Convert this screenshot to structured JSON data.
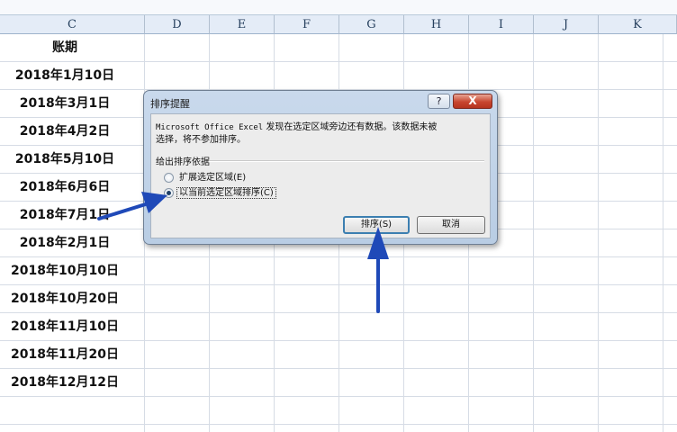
{
  "columns": [
    "C",
    "D",
    "E",
    "F",
    "G",
    "H",
    "I",
    "J",
    "K"
  ],
  "column_c_header": "账期",
  "column_c_values": [
    "2018年1月10日",
    "2018年3月1日",
    "2018年4月2日",
    "2018年5月10日",
    "2018年6月6日",
    "2018年7月1日",
    "2018年2月1日",
    "2018年10月10日",
    "2018年10月20日",
    "2018年11月10日",
    "2018年11月20日",
    "2018年12月12日"
  ],
  "dialog": {
    "title": "排序提醒",
    "help_label": "?",
    "close_label": "X",
    "message_line1_prefix": "Microsoft Office Excel",
    "message_line1_suffix": " 发现在选定区域旁边还有数据。该数据未被",
    "message_line2": "选择，将不参加排序。",
    "group_label": "给出排序依据",
    "option_expand": "扩展选定区域(E)",
    "option_current": "以当前选定区域排序(C)",
    "selected_option": "option_current",
    "sort_button": "排序(S)",
    "cancel_button": "取消"
  },
  "colors": {
    "arrow": "#1f49b8",
    "header_bg": "#e4ecf7",
    "dialog_frame": "#c9d9ec",
    "close_red": "#c8452f"
  }
}
